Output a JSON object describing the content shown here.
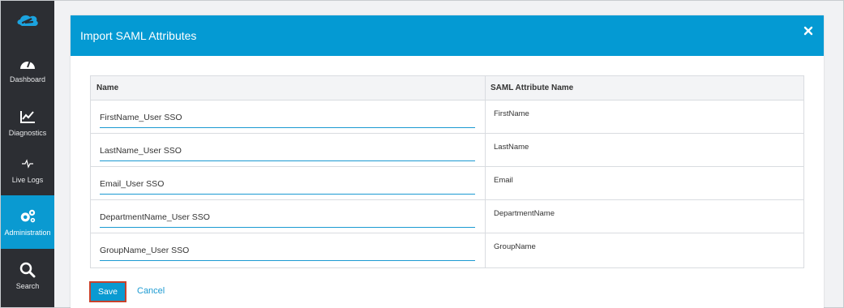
{
  "sidebar": {
    "logo_icon": "zscaler-cloud-icon",
    "items": [
      {
        "label": "Dashboard",
        "icon": "speedometer-icon",
        "active": false
      },
      {
        "label": "Diagnostics",
        "icon": "line-chart-icon",
        "active": false
      },
      {
        "label": "Live Logs",
        "icon": "pulse-icon",
        "active": false
      },
      {
        "label": "Administration",
        "icon": "gears-icon",
        "active": true
      },
      {
        "label": "Search",
        "icon": "search-icon",
        "active": false
      }
    ]
  },
  "modal": {
    "title": "Import SAML Attributes",
    "close_icon": "close-icon",
    "table": {
      "headers": [
        "Name",
        "SAML Attribute Name"
      ],
      "rows": [
        {
          "name": "FirstName_User SSO",
          "saml": "FirstName"
        },
        {
          "name": "LastName_User SSO",
          "saml": "LastName"
        },
        {
          "name": "Email_User SSO",
          "saml": "Email"
        },
        {
          "name": "DepartmentName_User SSO",
          "saml": "DepartmentName"
        },
        {
          "name": "GroupName_User SSO",
          "saml": "GroupName"
        }
      ]
    },
    "save_label": "Save",
    "cancel_label": "Cancel"
  },
  "colors": {
    "accent": "#049ad3",
    "sidebar_bg": "#2c2e33",
    "save_border": "#c8412b"
  }
}
